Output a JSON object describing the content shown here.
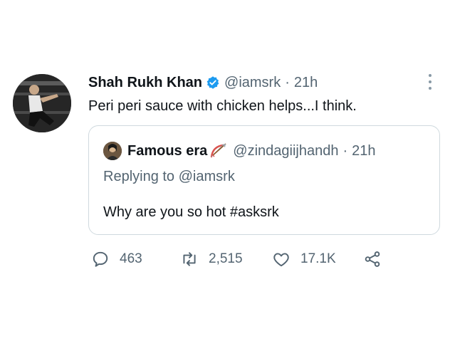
{
  "tweet": {
    "author_name": "Shah Rukh Khan",
    "author_handle": "@iamsrk",
    "separator": "·",
    "time": "21h",
    "text": "Peri peri sauce with chicken helps...I think.",
    "icons": {
      "verified": "verified-badge-icon",
      "more": "more-options-icon"
    },
    "accent_color": "#1d9bf0"
  },
  "quoted": {
    "author_name": "Famous era",
    "author_handle": "@zindagiijhandh",
    "separator": "·",
    "time": "21h",
    "replying_prefix": "Replying to ",
    "replying_handle": "@iamsrk",
    "text": "Why are you so hot #asksrk",
    "emoji": "bow-and-arrow-emoji"
  },
  "actions": {
    "reply_count": "463",
    "retweet_count": "2,515",
    "like_count": "17.1K",
    "icons": [
      "reply-icon",
      "retweet-icon",
      "like-icon",
      "share-icon"
    ]
  }
}
